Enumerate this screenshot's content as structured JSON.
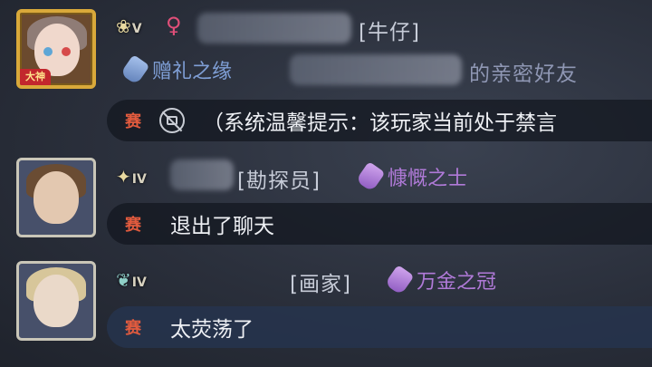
{
  "messages": [
    {
      "rank_label": "V",
      "gender_symbol": "♀",
      "identity": "[牛仔]",
      "avatar_badge": "大神",
      "relation_title": "赠礼之缘",
      "relation_suffix": "的亲密好友",
      "channel_badge": "赛",
      "text": "（系统温馨提示：该玩家当前处于禁言"
    },
    {
      "rank_label": "IV",
      "identity": "[勘探员]",
      "title": "慷慨之士",
      "channel_badge": "赛",
      "text": "退出了聊天"
    },
    {
      "rank_label": "IV",
      "identity": "[画家]",
      "title": "万金之冠",
      "channel_badge": "赛",
      "text": "太荧荡了"
    }
  ],
  "colors": {
    "bubble": "#12161e",
    "badge_red": "#e25b3e",
    "gem_blue": "#7f9fd6",
    "gem_purple": "#b07ad8",
    "gold_frame": "#d9a93a"
  },
  "icons": {
    "system_notice": "no-speaking-icon",
    "gem": "gem-icon"
  }
}
